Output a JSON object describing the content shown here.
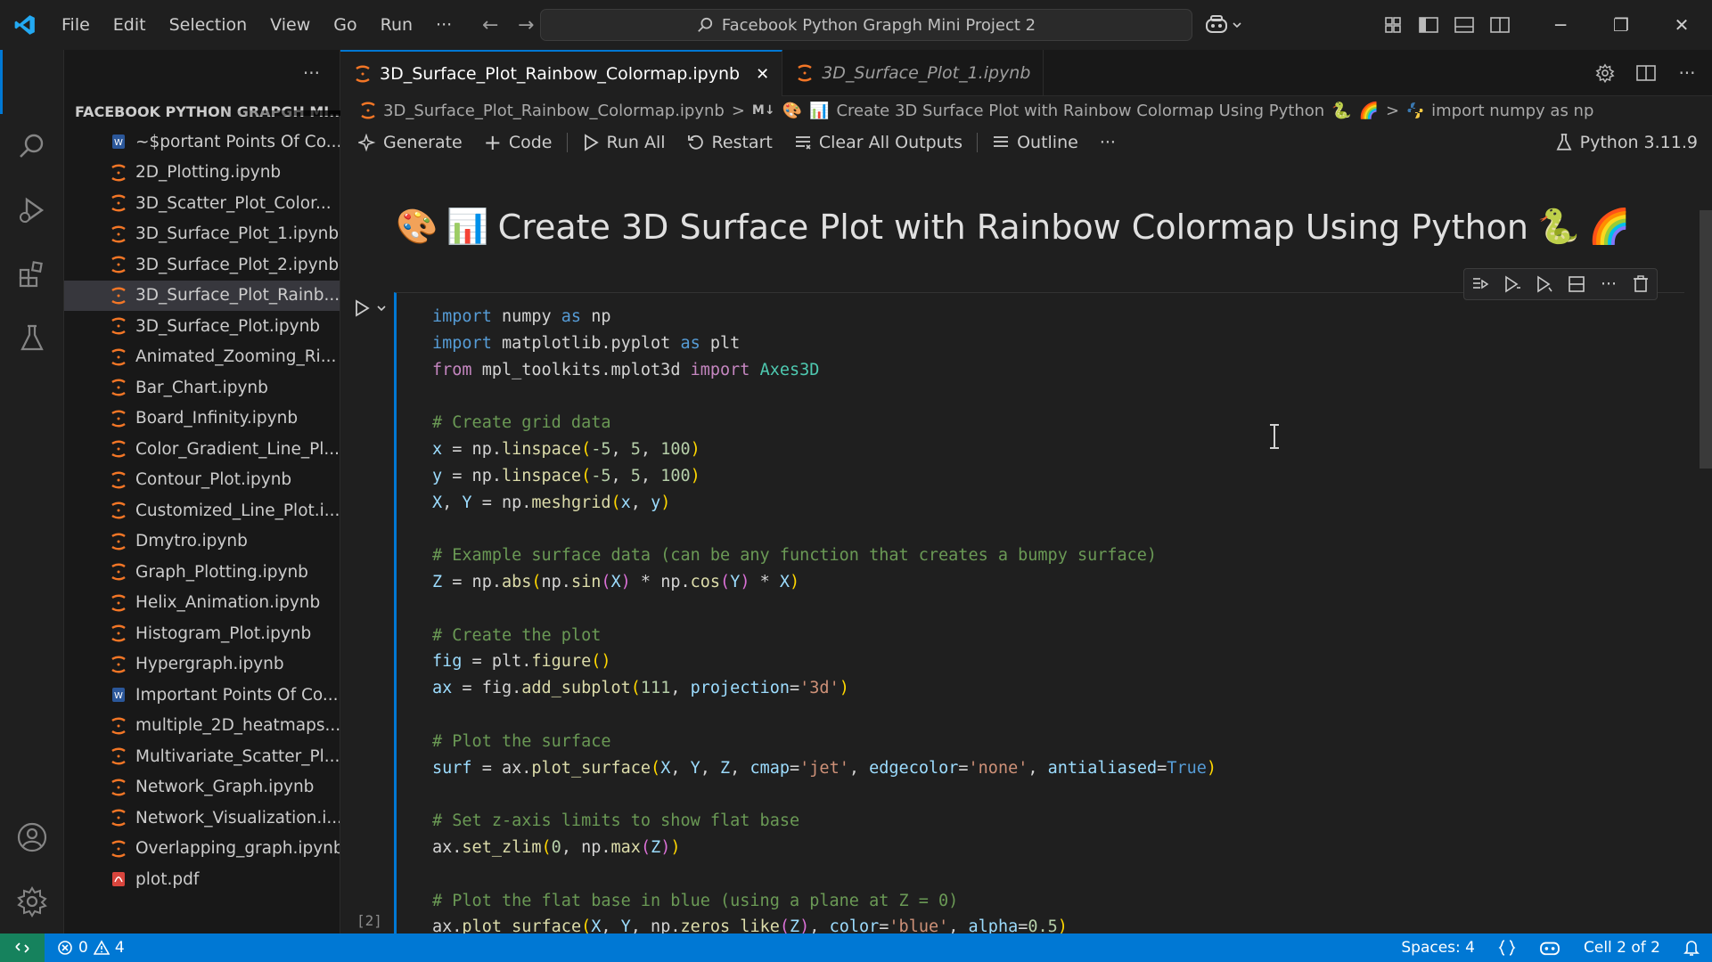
{
  "titlebar": {
    "menu": [
      "File",
      "Edit",
      "Selection",
      "View",
      "Go",
      "Run",
      "···"
    ],
    "back_arrow": "←",
    "forward_arrow": "→",
    "search_text": "Facebook Python Grapgh Mini Project 2",
    "window_controls": {
      "minimize": "─",
      "restore": "❐",
      "close": "✕"
    }
  },
  "sidebar": {
    "header_more": "···",
    "section_title": "FACEBOOK PYTHON GRAPGH MI...",
    "files": [
      {
        "name": "~$portant Points Of Co...",
        "type": "word"
      },
      {
        "name": "2D_Plotting.ipynb",
        "type": "notebook"
      },
      {
        "name": "3D_Scatter_Plot_Color...",
        "type": "notebook"
      },
      {
        "name": "3D_Surface_Plot_1.ipynb",
        "type": "notebook"
      },
      {
        "name": "3D_Surface_Plot_2.ipynb",
        "type": "notebook"
      },
      {
        "name": "3D_Surface_Plot_Rainb...",
        "type": "notebook",
        "selected": true
      },
      {
        "name": "3D_Surface_Plot.ipynb",
        "type": "notebook"
      },
      {
        "name": "Animated_Zooming_Ri...",
        "type": "notebook"
      },
      {
        "name": "Bar_Chart.ipynb",
        "type": "notebook"
      },
      {
        "name": "Board_Infinity.ipynb",
        "type": "notebook"
      },
      {
        "name": "Color_Gradient_Line_Pl...",
        "type": "notebook"
      },
      {
        "name": "Contour_Plot.ipynb",
        "type": "notebook"
      },
      {
        "name": "Customized_Line_Plot.i...",
        "type": "notebook"
      },
      {
        "name": "Dmytro.ipynb",
        "type": "notebook"
      },
      {
        "name": "Graph_Plotting.ipynb",
        "type": "notebook"
      },
      {
        "name": "Helix_Animation.ipynb",
        "type": "notebook"
      },
      {
        "name": "Histogram_Plot.ipynb",
        "type": "notebook"
      },
      {
        "name": "Hypergraph.ipynb",
        "type": "notebook"
      },
      {
        "name": "Important Points Of Co...",
        "type": "word"
      },
      {
        "name": "multiple_2D_heatmaps....",
        "type": "notebook"
      },
      {
        "name": "Multivariate_Scatter_Pl...",
        "type": "notebook"
      },
      {
        "name": "Network_Graph.ipynb",
        "type": "notebook"
      },
      {
        "name": "Network_Visualization.i...",
        "type": "notebook"
      },
      {
        "name": "Overlapping_graph.ipynb",
        "type": "notebook"
      },
      {
        "name": "plot.pdf",
        "type": "pdf"
      }
    ]
  },
  "tabs": [
    {
      "name": "3D_Surface_Plot_Rainbow_Colormap.ipynb",
      "active": true,
      "close": "✕"
    },
    {
      "name": "3D_Surface_Plot_1.ipynb",
      "active": false,
      "preview": true
    }
  ],
  "breadcrumb": {
    "file": "3D_Surface_Plot_Rainbow_Colormap.ipynb",
    "md_badge": "M↓",
    "heading": "Create 3D Surface Plot with Rainbow Colormap Using Python",
    "symbol": "import numpy as np",
    "sep": ">"
  },
  "toolbar": {
    "generate": "Generate",
    "code": "Code",
    "run_all": "Run All",
    "restart": "Restart",
    "clear_outputs": "Clear All Outputs",
    "outline": "Outline",
    "more": "···",
    "kernel": "Python 3.11.9"
  },
  "markdown_cell": {
    "heading": "Create 3D Surface Plot with Rainbow Colormap Using Python"
  },
  "code_cell": {
    "execution_count": "[2]",
    "lines": [
      [
        [
          "kw",
          "import"
        ],
        [
          "id",
          " numpy "
        ],
        [
          "kw",
          "as"
        ],
        [
          "id",
          " np"
        ]
      ],
      [
        [
          "kw",
          "import"
        ],
        [
          "id",
          " matplotlib.pyplot "
        ],
        [
          "kw",
          "as"
        ],
        [
          "id",
          " plt"
        ]
      ],
      [
        [
          "kw2",
          "from"
        ],
        [
          "id",
          " mpl_toolkits.mplot3d "
        ],
        [
          "kw2",
          "import"
        ],
        [
          "mod",
          " Axes3D"
        ]
      ],
      [],
      [
        [
          "cm",
          "# Create grid data"
        ]
      ],
      [
        [
          "var",
          "x"
        ],
        [
          "op",
          " = np."
        ],
        [
          "fn",
          "linspace"
        ],
        [
          "br1",
          "("
        ],
        [
          "num",
          "-5"
        ],
        [
          "op",
          ", "
        ],
        [
          "num",
          "5"
        ],
        [
          "op",
          ", "
        ],
        [
          "num",
          "100"
        ],
        [
          "br1",
          ")"
        ]
      ],
      [
        [
          "var",
          "y"
        ],
        [
          "op",
          " = np."
        ],
        [
          "fn",
          "linspace"
        ],
        [
          "br1",
          "("
        ],
        [
          "num",
          "-5"
        ],
        [
          "op",
          ", "
        ],
        [
          "num",
          "5"
        ],
        [
          "op",
          ", "
        ],
        [
          "num",
          "100"
        ],
        [
          "br1",
          ")"
        ]
      ],
      [
        [
          "var",
          "X"
        ],
        [
          "op",
          ", "
        ],
        [
          "var",
          "Y"
        ],
        [
          "op",
          " = np."
        ],
        [
          "fn",
          "meshgrid"
        ],
        [
          "br1",
          "("
        ],
        [
          "var",
          "x"
        ],
        [
          "op",
          ", "
        ],
        [
          "var",
          "y"
        ],
        [
          "br1",
          ")"
        ]
      ],
      [],
      [
        [
          "cm",
          "# Example surface data (can be any function that creates a bumpy surface)"
        ]
      ],
      [
        [
          "var",
          "Z"
        ],
        [
          "op",
          " = np."
        ],
        [
          "fn",
          "abs"
        ],
        [
          "br1",
          "("
        ],
        [
          "op",
          "np."
        ],
        [
          "fn",
          "sin"
        ],
        [
          "br2",
          "("
        ],
        [
          "var",
          "X"
        ],
        [
          "br2",
          ")"
        ],
        [
          "op",
          " * np."
        ],
        [
          "fn",
          "cos"
        ],
        [
          "br2",
          "("
        ],
        [
          "var",
          "Y"
        ],
        [
          "br2",
          ")"
        ],
        [
          "op",
          " * "
        ],
        [
          "var",
          "X"
        ],
        [
          "br1",
          ")"
        ]
      ],
      [],
      [
        [
          "cm",
          "# Create the plot"
        ]
      ],
      [
        [
          "var",
          "fig"
        ],
        [
          "op",
          " = plt."
        ],
        [
          "fn",
          "figure"
        ],
        [
          "br1",
          "()"
        ]
      ],
      [
        [
          "var",
          "ax"
        ],
        [
          "op",
          " = fig."
        ],
        [
          "fn",
          "add_subplot"
        ],
        [
          "br1",
          "("
        ],
        [
          "num",
          "111"
        ],
        [
          "op",
          ", "
        ],
        [
          "var",
          "projection"
        ],
        [
          "op",
          "="
        ],
        [
          "str",
          "'3d'"
        ],
        [
          "br1",
          ")"
        ]
      ],
      [],
      [
        [
          "cm",
          "# Plot the surface"
        ]
      ],
      [
        [
          "var",
          "surf"
        ],
        [
          "op",
          " = ax."
        ],
        [
          "fn",
          "plot_surface"
        ],
        [
          "br1",
          "("
        ],
        [
          "var",
          "X"
        ],
        [
          "op",
          ", "
        ],
        [
          "var",
          "Y"
        ],
        [
          "op",
          ", "
        ],
        [
          "var",
          "Z"
        ],
        [
          "op",
          ", "
        ],
        [
          "var",
          "cmap"
        ],
        [
          "op",
          "="
        ],
        [
          "str",
          "'jet'"
        ],
        [
          "op",
          ", "
        ],
        [
          "var",
          "edgecolor"
        ],
        [
          "op",
          "="
        ],
        [
          "str",
          "'none'"
        ],
        [
          "op",
          ", "
        ],
        [
          "var",
          "antialiased"
        ],
        [
          "op",
          "="
        ],
        [
          "const",
          "True"
        ],
        [
          "br1",
          ")"
        ]
      ],
      [],
      [
        [
          "cm",
          "# Set z-axis limits to show flat base"
        ]
      ],
      [
        [
          "op",
          "ax."
        ],
        [
          "fn",
          "set_zlim"
        ],
        [
          "br1",
          "("
        ],
        [
          "num",
          "0"
        ],
        [
          "op",
          ", np."
        ],
        [
          "fn",
          "max"
        ],
        [
          "br2",
          "("
        ],
        [
          "var",
          "Z"
        ],
        [
          "br2",
          ")"
        ],
        [
          "br1",
          ")"
        ]
      ],
      [],
      [
        [
          "cm",
          "# Plot the flat base in blue (using a plane at Z = 0)"
        ]
      ],
      [
        [
          "op",
          "ax."
        ],
        [
          "fn",
          "plot_surface"
        ],
        [
          "br1",
          "("
        ],
        [
          "var",
          "X"
        ],
        [
          "op",
          ", "
        ],
        [
          "var",
          "Y"
        ],
        [
          "op",
          ", np."
        ],
        [
          "fn",
          "zeros_like"
        ],
        [
          "br2",
          "("
        ],
        [
          "var",
          "Z"
        ],
        [
          "br2",
          ")"
        ],
        [
          "op",
          ", "
        ],
        [
          "var",
          "color"
        ],
        [
          "op",
          "="
        ],
        [
          "str",
          "'blue'"
        ],
        [
          "op",
          ", "
        ],
        [
          "var",
          "alpha"
        ],
        [
          "op",
          "="
        ],
        [
          "num",
          "0.5"
        ],
        [
          "br1",
          ")"
        ]
      ]
    ]
  },
  "statusbar": {
    "errors": "0",
    "warnings": "4",
    "spaces": "Spaces: 4",
    "cell": "Cell 2 of 2"
  },
  "colors": {
    "accent": "#0078d4",
    "statusbar": "#0078d4",
    "remote": "#16825d"
  }
}
